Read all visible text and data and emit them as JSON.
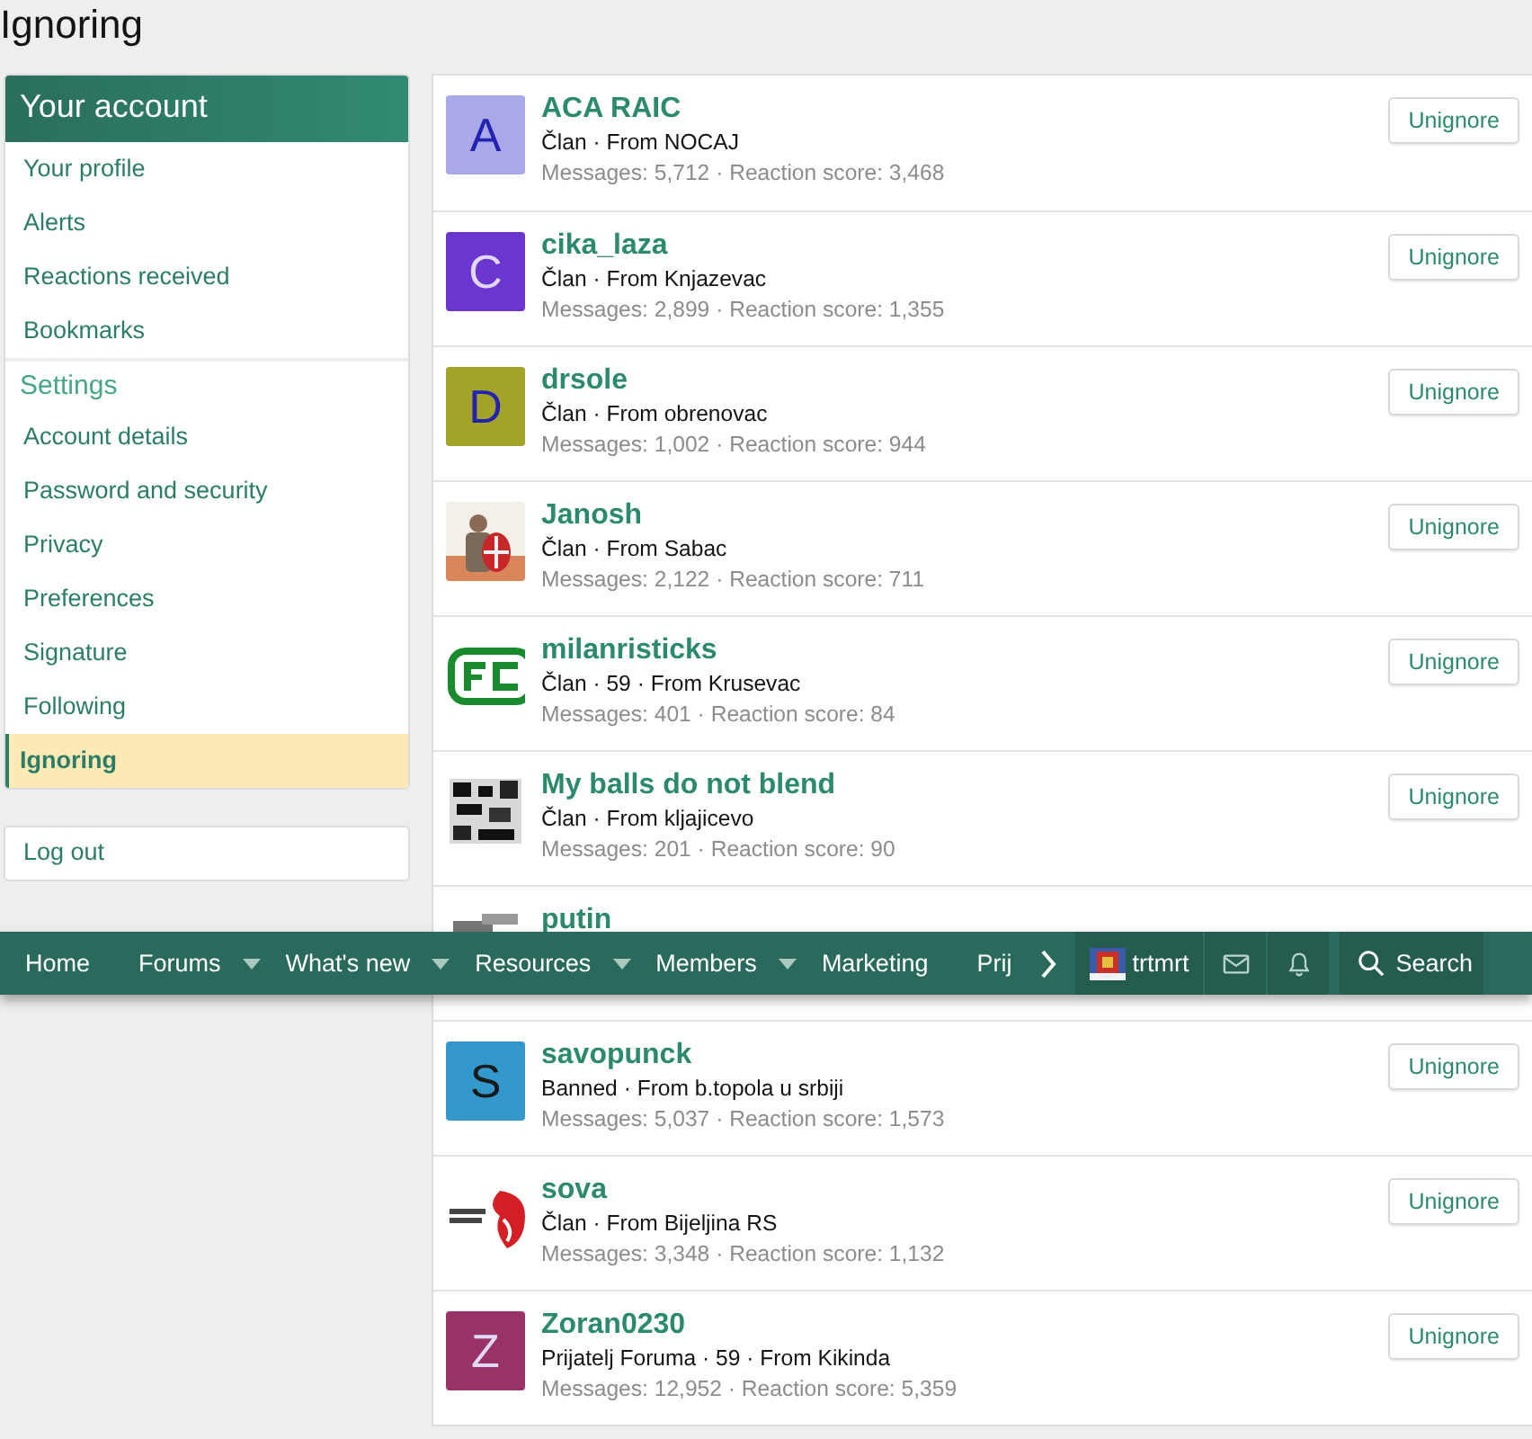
{
  "page_title": "Ignoring",
  "sidebar": {
    "header": "Your account",
    "sections": [
      {
        "items": [
          {
            "label": "Your profile",
            "selected": false
          },
          {
            "label": "Alerts",
            "selected": false
          },
          {
            "label": "Reactions received",
            "selected": false
          },
          {
            "label": "Bookmarks",
            "selected": false
          }
        ]
      },
      {
        "title": "Settings",
        "items": [
          {
            "label": "Account details",
            "selected": false
          },
          {
            "label": "Password and security",
            "selected": false
          },
          {
            "label": "Privacy",
            "selected": false
          },
          {
            "label": "Preferences",
            "selected": false
          },
          {
            "label": "Signature",
            "selected": false
          },
          {
            "label": "Following",
            "selected": false
          },
          {
            "label": "Ignoring",
            "selected": true
          }
        ]
      }
    ],
    "logout": "Log out"
  },
  "users": [
    {
      "name": "ACA RAIC",
      "avatar": {
        "kind": "letter",
        "letter": "A",
        "color": "#a9a9ea"
      },
      "info": "Član · From NOCAJ",
      "stats": "Messages: 5,712 · Reaction score: 3,468",
      "button": "Unignore"
    },
    {
      "name": "cika_laza",
      "avatar": {
        "kind": "letter",
        "letter": "C",
        "color": "#6b35d0"
      },
      "info": "Član · From Knjazevac",
      "stats": "Messages: 2,899 · Reaction score: 1,355",
      "button": "Unignore"
    },
    {
      "name": "drsole",
      "avatar": {
        "kind": "letter",
        "letter": "D",
        "color": "#a3a32a"
      },
      "info": "Član · From obrenovac",
      "stats": "Messages: 1,002 · Reaction score: 944",
      "button": "Unignore"
    },
    {
      "name": "Janosh",
      "info": "Član · From Sabac",
      "stats": "Messages: 2,122 · Reaction score: 711",
      "button": "Unignore"
    },
    {
      "name": "milanristicks",
      "info": "Član · 59 · From Krusevac",
      "stats": "Messages: 401 · Reaction score: 84",
      "button": "Unignore"
    },
    {
      "name": "My balls do not blend",
      "info": "Član · From kljajicevo",
      "stats": "Messages: 201 · Reaction score: 90",
      "button": "Unignore"
    },
    {
      "name": "putin"
    },
    {
      "name": "savopunck",
      "avatar": {
        "kind": "letter",
        "letter": "S",
        "color": "#3399cc"
      },
      "info": "Banned · From b.topola u srbiji",
      "stats": "Messages: 5,037 · Reaction score: 1,573",
      "button": "Unignore"
    },
    {
      "name": "sova",
      "info": "Član · From Bijeljina RS",
      "stats": "Messages: 3,348 · Reaction score: 1,132",
      "button": "Unignore"
    },
    {
      "name": "Zoran0230",
      "avatar": {
        "kind": "letter",
        "letter": "Z",
        "color": "#993366"
      },
      "info": "Prijatelj Foruma · 59 · From Kikinda",
      "stats": "Messages: 12,952 · Reaction score: 5,359",
      "button": "Unignore"
    }
  ],
  "navbar": {
    "items": [
      {
        "label": "Home",
        "dropdown": false
      },
      {
        "label": "Forums",
        "dropdown": true
      },
      {
        "label": "What's new",
        "dropdown": true
      },
      {
        "label": "Resources",
        "dropdown": true
      },
      {
        "label": "Members",
        "dropdown": true
      },
      {
        "label": "Marketing",
        "dropdown": false
      },
      {
        "label": "Prij",
        "dropdown": false
      }
    ],
    "username": "trtmrt",
    "search": "Search"
  }
}
